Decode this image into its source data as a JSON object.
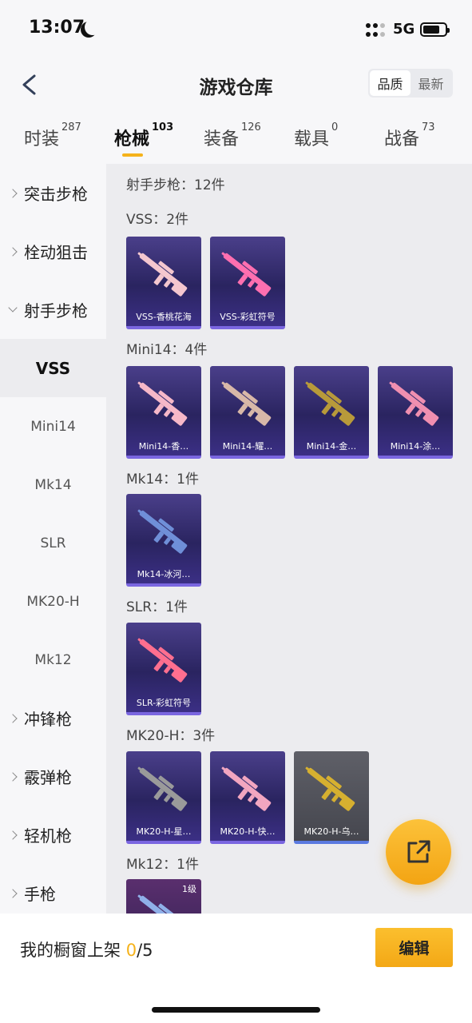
{
  "status": {
    "time": "13:07",
    "network": "5G"
  },
  "header": {
    "title": "游戏仓库",
    "sort_options": [
      "品质",
      "最新"
    ],
    "sort_active": 0
  },
  "tabs": [
    {
      "label": "时装",
      "count": "287"
    },
    {
      "label": "枪械",
      "count": "103"
    },
    {
      "label": "装备",
      "count": "126"
    },
    {
      "label": "载具",
      "count": "0"
    },
    {
      "label": "战备",
      "count": "73"
    }
  ],
  "active_tab": 1,
  "sidebar": [
    {
      "label": "突击步枪",
      "type": "cat"
    },
    {
      "label": "栓动狙击",
      "type": "cat"
    },
    {
      "label": "射手步枪",
      "type": "cat",
      "open": true
    },
    {
      "label": "VSS",
      "type": "sub",
      "active": true
    },
    {
      "label": "Mini14",
      "type": "sub"
    },
    {
      "label": "Mk14",
      "type": "sub"
    },
    {
      "label": "SLR",
      "type": "sub"
    },
    {
      "label": "MK20-H",
      "type": "sub"
    },
    {
      "label": "Mk12",
      "type": "sub"
    },
    {
      "label": "冲锋枪",
      "type": "cat"
    },
    {
      "label": "霰弹枪",
      "type": "cat"
    },
    {
      "label": "轻机枪",
      "type": "cat"
    },
    {
      "label": "手枪",
      "type": "cat"
    }
  ],
  "content": {
    "category_title": "射手步枪：12件",
    "sections": [
      {
        "title": "VSS：2件",
        "items": [
          {
            "label": "VSS-香桃花海",
            "style": "purple",
            "gun": "#f4c7cf"
          },
          {
            "label": "VSS-彩虹符号",
            "style": "purple",
            "gun": "#ff6fb0"
          }
        ]
      },
      {
        "title": "Mini14：4件",
        "items": [
          {
            "label": "Mini14-香…",
            "style": "purple",
            "gun": "#f6b8c8"
          },
          {
            "label": "Mini14-耀…",
            "style": "purple",
            "gun": "#d8b8a8"
          },
          {
            "label": "Mini14-金…",
            "style": "purple",
            "gun": "#b89a3a"
          },
          {
            "label": "Mini14-涂…",
            "style": "purple",
            "gun": "#f08fb0"
          }
        ]
      },
      {
        "title": "Mk14：1件",
        "items": [
          {
            "label": "Mk14-冰河…",
            "style": "purple",
            "gun": "#6f8fd8"
          }
        ]
      },
      {
        "title": "SLR：1件",
        "items": [
          {
            "label": "SLR-彩虹符号",
            "style": "purple",
            "gun": "#ff6f8f"
          }
        ]
      },
      {
        "title": "MK20-H：3件",
        "items": [
          {
            "label": "MK20-H-星…",
            "style": "purple",
            "gun": "#9a9a9a"
          },
          {
            "label": "MK20-H-快…",
            "style": "purple",
            "gun": "#f2a6c0"
          },
          {
            "label": "MK20-H-乌…",
            "style": "gray",
            "gun": "#d6b030"
          }
        ]
      },
      {
        "title": "Mk12：1件",
        "items": [
          {
            "label": "",
            "style": "mag",
            "gun": "#8fb0e8",
            "level": "1级"
          }
        ]
      }
    ]
  },
  "bottom": {
    "showcase_label": "我的橱窗上架",
    "showcase_count": "0",
    "showcase_total": "/5",
    "edit_label": "编辑"
  },
  "colors": {
    "accent": "#f5b21a",
    "card_bg": "#2a2460",
    "card_border": "#7a66e0"
  }
}
